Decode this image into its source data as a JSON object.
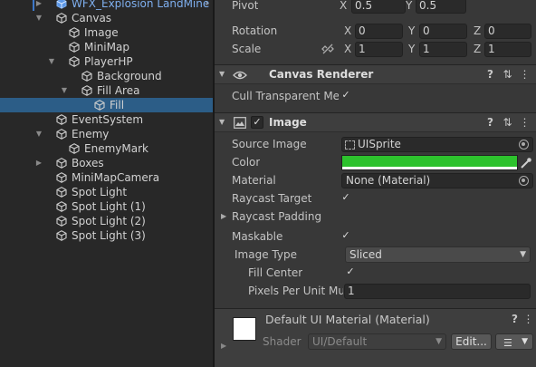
{
  "hierarchy": {
    "items": [
      {
        "label": "WFX_Explosion LandMine",
        "prefab": true,
        "arrow": "right"
      },
      {
        "label": "Canvas",
        "arrow": "down"
      },
      {
        "label": "Image"
      },
      {
        "label": "MiniMap"
      },
      {
        "label": "PlayerHP",
        "arrow": "down"
      },
      {
        "label": "Background"
      },
      {
        "label": "Fill Area",
        "arrow": "down"
      },
      {
        "label": "Fill",
        "selected": true
      },
      {
        "label": "EventSystem"
      },
      {
        "label": "Enemy",
        "arrow": "down"
      },
      {
        "label": "EnemyMark"
      },
      {
        "label": "Boxes",
        "arrow": "right"
      },
      {
        "label": "MiniMapCamera"
      },
      {
        "label": "Spot Light"
      },
      {
        "label": "Spot Light (1)"
      },
      {
        "label": "Spot Light (2)"
      },
      {
        "label": "Spot Light (3)"
      }
    ],
    "goto_chevron": "›"
  },
  "transform": {
    "pivot": {
      "label": "Pivot",
      "x": "0.5",
      "y": "0.5"
    },
    "rotation": {
      "label": "Rotation",
      "x": "0",
      "y": "0",
      "z": "0"
    },
    "scale": {
      "label": "Scale",
      "x": "1",
      "y": "1",
      "z": "1"
    },
    "axis": {
      "x": "X",
      "y": "Y",
      "z": "Z"
    }
  },
  "canvas_renderer": {
    "title": "Canvas Renderer",
    "cull_label": "Cull Transparent Mes",
    "cull_checked": true
  },
  "image": {
    "title": "Image",
    "enabled": true,
    "source_image_label": "Source Image",
    "source_image_value": "UISprite",
    "color_label": "Color",
    "color_value": "#2dc22d",
    "material_label": "Material",
    "material_value": "None (Material)",
    "raycast_target_label": "Raycast Target",
    "raycast_target_checked": true,
    "raycast_padding_label": "Raycast Padding",
    "maskable_label": "Maskable",
    "maskable_checked": true,
    "image_type_label": "Image Type",
    "image_type_value": "Sliced",
    "fill_center_label": "Fill Center",
    "fill_center_checked": true,
    "pixels_per_unit_label": "Pixels Per Unit Mul",
    "pixels_per_unit_value": "1"
  },
  "material_block": {
    "title": "Default UI Material (Material)",
    "shader_label": "Shader",
    "shader_value": "UI/Default",
    "edit_label": "Edit..."
  },
  "icons": {
    "help": "?",
    "presets": "⇅",
    "menu": "⋮",
    "checkmark": "✓"
  },
  "colors": {
    "selection": "#2c5d87",
    "prefab_text": "#7fb0f0",
    "image_color": "#2dc22d"
  }
}
